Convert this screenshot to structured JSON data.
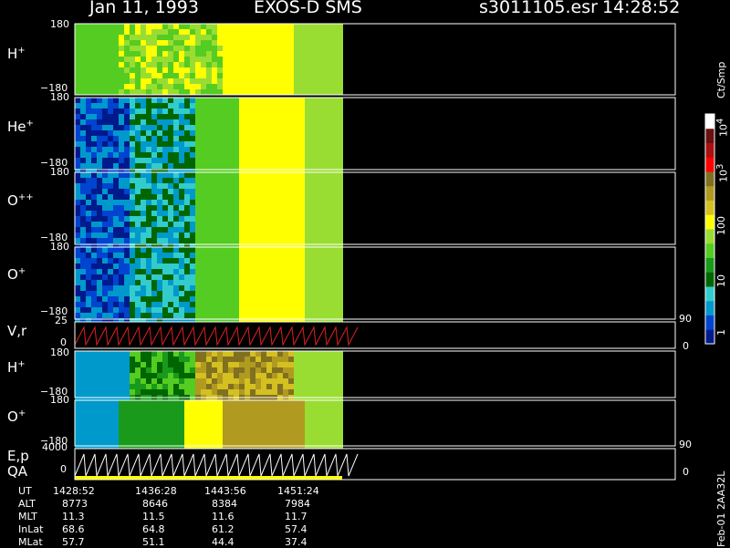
{
  "header": {
    "date": "Jan 11, 1993",
    "instrument": "EXOS-D SMS",
    "file": "s3011105.esr",
    "time": "14:28:52"
  },
  "colorbar": {
    "unit_label": "Ct/Smp",
    "ticks": [
      "10",
      "10",
      "10",
      "100",
      "10",
      "1"
    ],
    "exponents": [
      "4",
      "3"
    ]
  },
  "panels": [
    {
      "id": "H+",
      "label": "H",
      "sup": "+",
      "ymax": "180",
      "ymin": "−180"
    },
    {
      "id": "He+",
      "label": "He",
      "sup": "+",
      "ymax": "180",
      "ymin": "−180"
    },
    {
      "id": "O++",
      "label": "O",
      "sup": "++",
      "ymax": "180",
      "ymin": "−180"
    },
    {
      "id": "O+",
      "label": "O",
      "sup": "+",
      "ymax": "180",
      "ymin": "−180"
    },
    {
      "id": "Vr",
      "label": "V,r",
      "sup": "",
      "ymax": "25",
      "ymin": "0",
      "right_top": "90",
      "right_bottom": "0"
    },
    {
      "id": "H+2",
      "label": "H",
      "sup": "+",
      "ymax": "180",
      "ymin": "−180"
    },
    {
      "id": "O+2",
      "label": "O",
      "sup": "+",
      "ymax": "180",
      "ymin": "−180"
    },
    {
      "id": "Ep",
      "label": "E,p",
      "label2": "QA",
      "ymax": "4000",
      "ymin": "0",
      "right_top": "90",
      "right_bottom": "0"
    }
  ],
  "ephemeris": {
    "rows": [
      {
        "name": "UT",
        "values": [
          "1428:52",
          "1436:28",
          "1443:56",
          "1451:24"
        ]
      },
      {
        "name": "ALT",
        "values": [
          "8773",
          "8646",
          "8384",
          "7984"
        ]
      },
      {
        "name": "MLT",
        "values": [
          "11.3",
          "11.5",
          "11.6",
          "11.7"
        ]
      },
      {
        "name": "InLat",
        "values": [
          "68.6",
          "64.8",
          "61.2",
          "57.4"
        ]
      },
      {
        "name": "MLat",
        "values": [
          "57.7",
          "51.1",
          "44.4",
          "37.4"
        ]
      }
    ]
  },
  "footer_tag": "Feb-01 2AA32L",
  "chart_data": {
    "type": "heatmap",
    "title": "Jan 11, 1993   EXOS-D SMS",
    "x_ticks": [
      "1428:52",
      "1436:28",
      "1443:56",
      "1451:24"
    ],
    "panel_names": [
      "H+",
      "He+",
      "O++",
      "O+",
      "V,r",
      "H+",
      "O+",
      "E,p QA"
    ],
    "color_scale": {
      "unit": "Ct/Smp",
      "range": [
        1,
        10000
      ],
      "log": true,
      "colors": [
        "#001a8c",
        "#0044d0",
        "#0099cc",
        "#33cccc",
        "#006600",
        "#1a9a1a",
        "#55cc22",
        "#99dd33",
        "#ffff00",
        "#d4c020",
        "#b09a20",
        "#807020",
        "#ff0000",
        "#aa1010",
        "#6b1010",
        "#ffffff"
      ]
    },
    "data_fraction_of_time_axis": 0.35
  }
}
